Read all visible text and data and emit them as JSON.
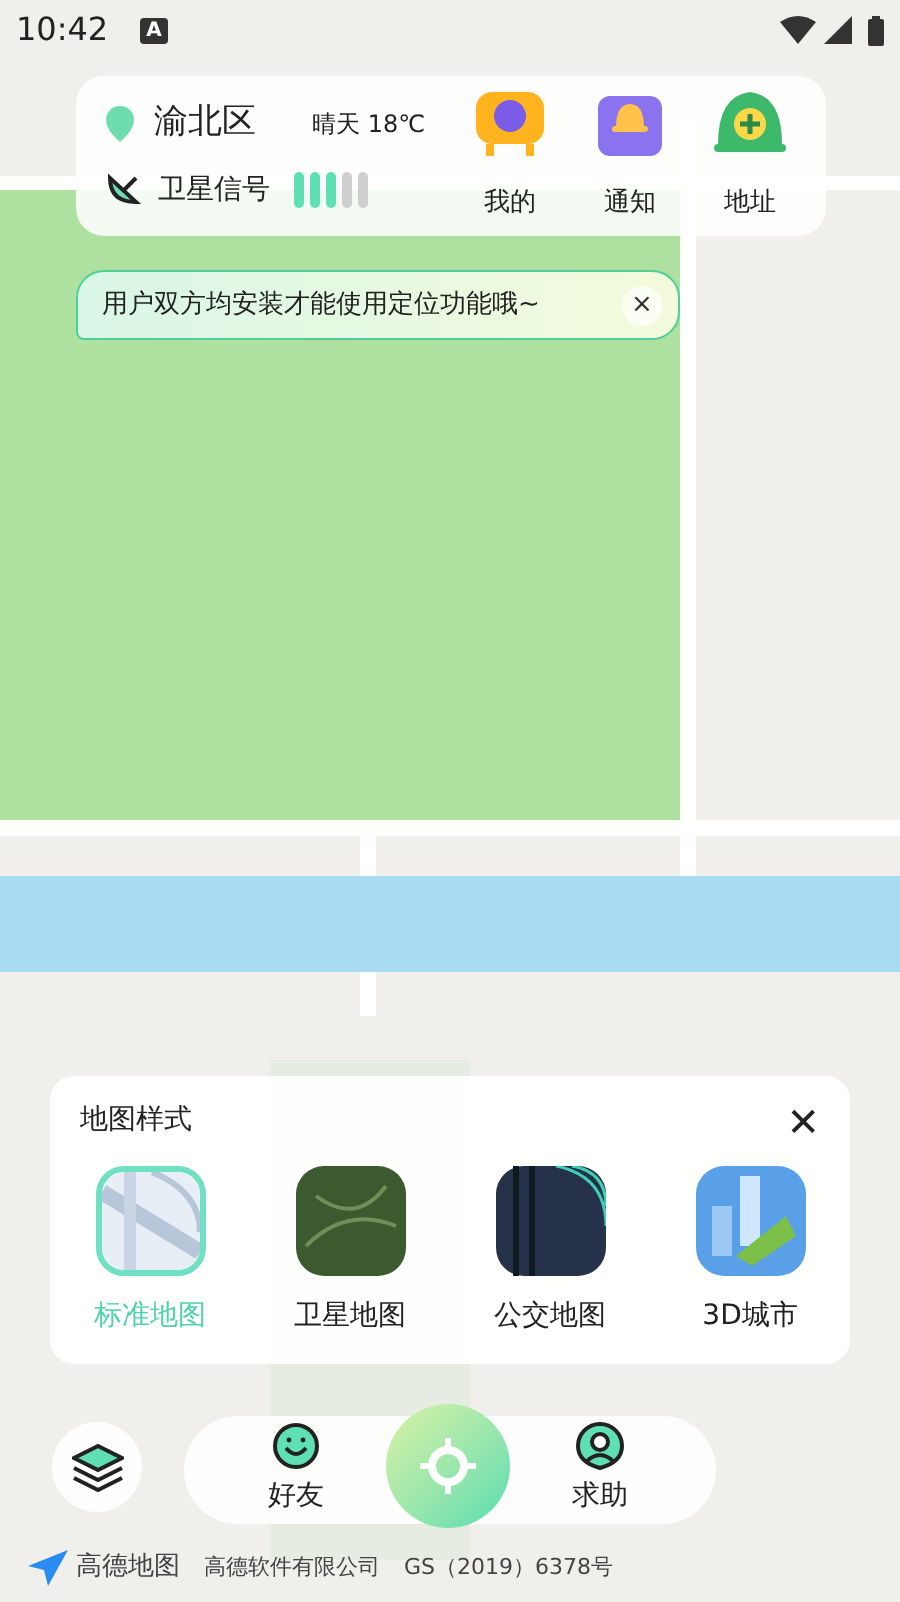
{
  "status_bar": {
    "time": "10:42",
    "badge": "A"
  },
  "top_card": {
    "district": "渝北区",
    "weather": "晴天 18℃",
    "signal_label": "卫星信号",
    "signal": {
      "level": 0.6
    },
    "actions": [
      {
        "label": "我的"
      },
      {
        "label": "通知"
      },
      {
        "label": "地址"
      }
    ]
  },
  "toast": {
    "text": "用户双方均安装才能使用定位功能哦~",
    "close": "×"
  },
  "map_style_panel": {
    "title": "地图样式",
    "close": "✕",
    "options": [
      {
        "label": "标准地图",
        "kind": "standard",
        "selected": true
      },
      {
        "label": "卫星地图",
        "kind": "satellite",
        "selected": false
      },
      {
        "label": "公交地图",
        "kind": "transit",
        "selected": false
      },
      {
        "label": "3D城市",
        "kind": "city3d",
        "selected": false
      }
    ]
  },
  "bottom_bar": {
    "friends": "好友",
    "help": "求助"
  },
  "attribution": {
    "logo_text": "高德地图",
    "company": "高德软件有限公司",
    "license": "GS（2019）6378号"
  }
}
